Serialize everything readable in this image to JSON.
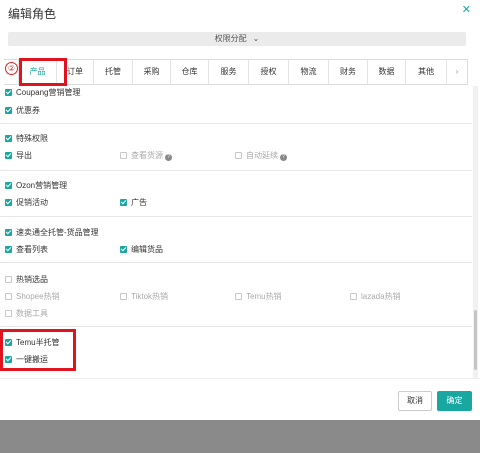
{
  "dialog": {
    "title": "编辑角色",
    "close_icon": "close-icon",
    "permission_toggle": "权限分配",
    "step_marker": "②"
  },
  "tabs": [
    "产品",
    "订单",
    "托管",
    "采购",
    "仓库",
    "服务",
    "授权",
    "物流",
    "财务",
    "数据",
    "其他"
  ],
  "active_tab": "产品",
  "sections": {
    "coupang": {
      "parent": "Coupang营销管理",
      "children": [
        "优惠券"
      ]
    },
    "special": {
      "parent": "特殊权限",
      "children": [
        "导出",
        "查看货源",
        "自动延续"
      ]
    },
    "ozon": {
      "parent": "Ozon营销管理",
      "children": [
        "促销活动",
        "广告"
      ]
    },
    "aliexpress": {
      "parent": "速卖通全托管-货品管理",
      "children": [
        "查看列表",
        "编辑货品"
      ]
    },
    "hot": {
      "parent": "热销选品",
      "children": [
        "Shopee热销",
        "Tiktok热销",
        "Temu热销",
        "lazada热销",
        "数据工具"
      ]
    },
    "temu": {
      "parent": "Temu半托管",
      "children": [
        "一键搬运"
      ]
    }
  },
  "buttons": {
    "cancel": "取消",
    "confirm": "确定"
  },
  "colors": {
    "accent": "#19a7a1",
    "highlight": "#e0141e"
  }
}
